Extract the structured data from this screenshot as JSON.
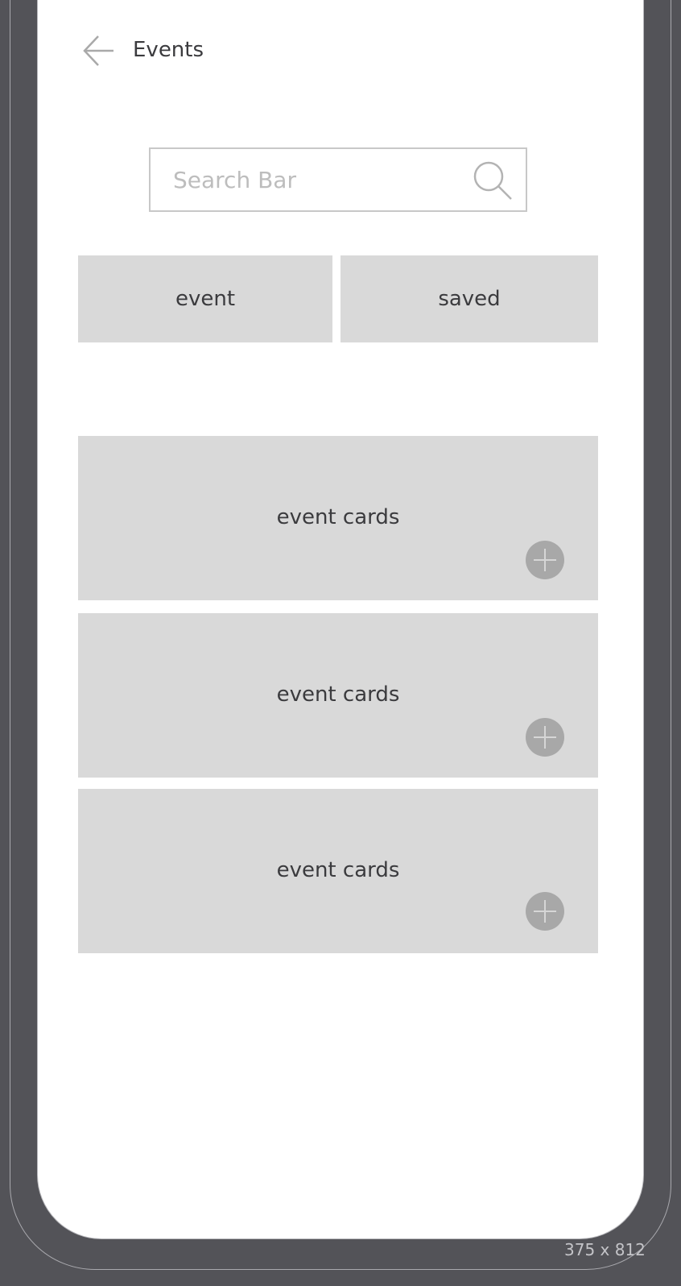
{
  "header": {
    "back_icon": "arrow-left-icon",
    "title": "Events"
  },
  "search": {
    "placeholder": "Search Bar",
    "value": "",
    "icon": "search-icon"
  },
  "tabs": [
    {
      "label": "event"
    },
    {
      "label": "saved"
    }
  ],
  "cards": [
    {
      "label": "event cards",
      "action_icon": "plus-icon"
    },
    {
      "label": "event cards",
      "action_icon": "plus-icon"
    },
    {
      "label": "event cards",
      "action_icon": "plus-icon"
    }
  ],
  "canvas": {
    "size_label": "375 x 812"
  },
  "colors": {
    "background": "#535358",
    "screen": "#ffffff",
    "placeholder_fill": "#d9d9d9",
    "add_button": "#a8a8a8",
    "text": "#3b3b3e"
  }
}
